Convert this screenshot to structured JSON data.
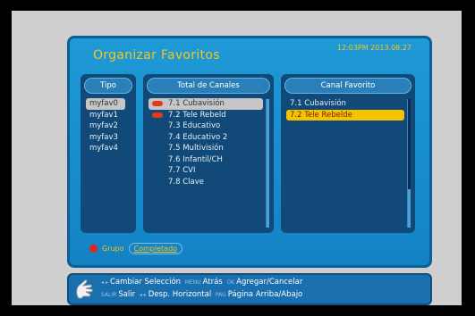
{
  "header": {
    "title": "Organizar Favoritos",
    "datetime": "12:03PM  2013.08.27"
  },
  "columns": {
    "tipo": {
      "header": "Tipo",
      "items": [
        "myfav0",
        "myfav1",
        "myfav2",
        "myfav3",
        "myfav4"
      ],
      "selected_index": 0
    },
    "total": {
      "header": "Total de Canales",
      "items": [
        {
          "label": "7.1 Cubavisión",
          "marked": true
        },
        {
          "label": "7.2 Tele Rebeld",
          "marked": true
        },
        {
          "label": "7.3 Educativo",
          "marked": false
        },
        {
          "label": "7.4 Educativo 2",
          "marked": false
        },
        {
          "label": "7.5 Multivisión",
          "marked": false
        },
        {
          "label": "7.6 Infantil/CH",
          "marked": false
        },
        {
          "label": "7.7 CVI",
          "marked": false
        },
        {
          "label": "7.8 Clave",
          "marked": false
        }
      ],
      "selected_index": 0
    },
    "favorito": {
      "header": "Canal Favorito",
      "items": [
        "7.1 Cubavisión",
        "7.2 Tele Rebelde"
      ],
      "selected_index": 1
    }
  },
  "bottom": {
    "grupo_label": "Grupo",
    "status": "Completado"
  },
  "help": {
    "line1": {
      "key1": "◂ ▸",
      "action1": "Cambiar Selección",
      "key2": "MENU",
      "action2": "Atrás",
      "key3": "OK",
      "action3": "Agregar/Cancelar"
    },
    "line2": {
      "key1": "SALIR",
      "action1": "Salir",
      "key2": "◂ ▸",
      "action2": "Desp. Horizontal",
      "key3": "PAG",
      "action3": "Página Arriba/Abajo"
    }
  },
  "colors": {
    "accent_yellow": "#f7c51e",
    "dialog_blue": "#1a8fd0",
    "marker_red": "#e23a1a"
  }
}
